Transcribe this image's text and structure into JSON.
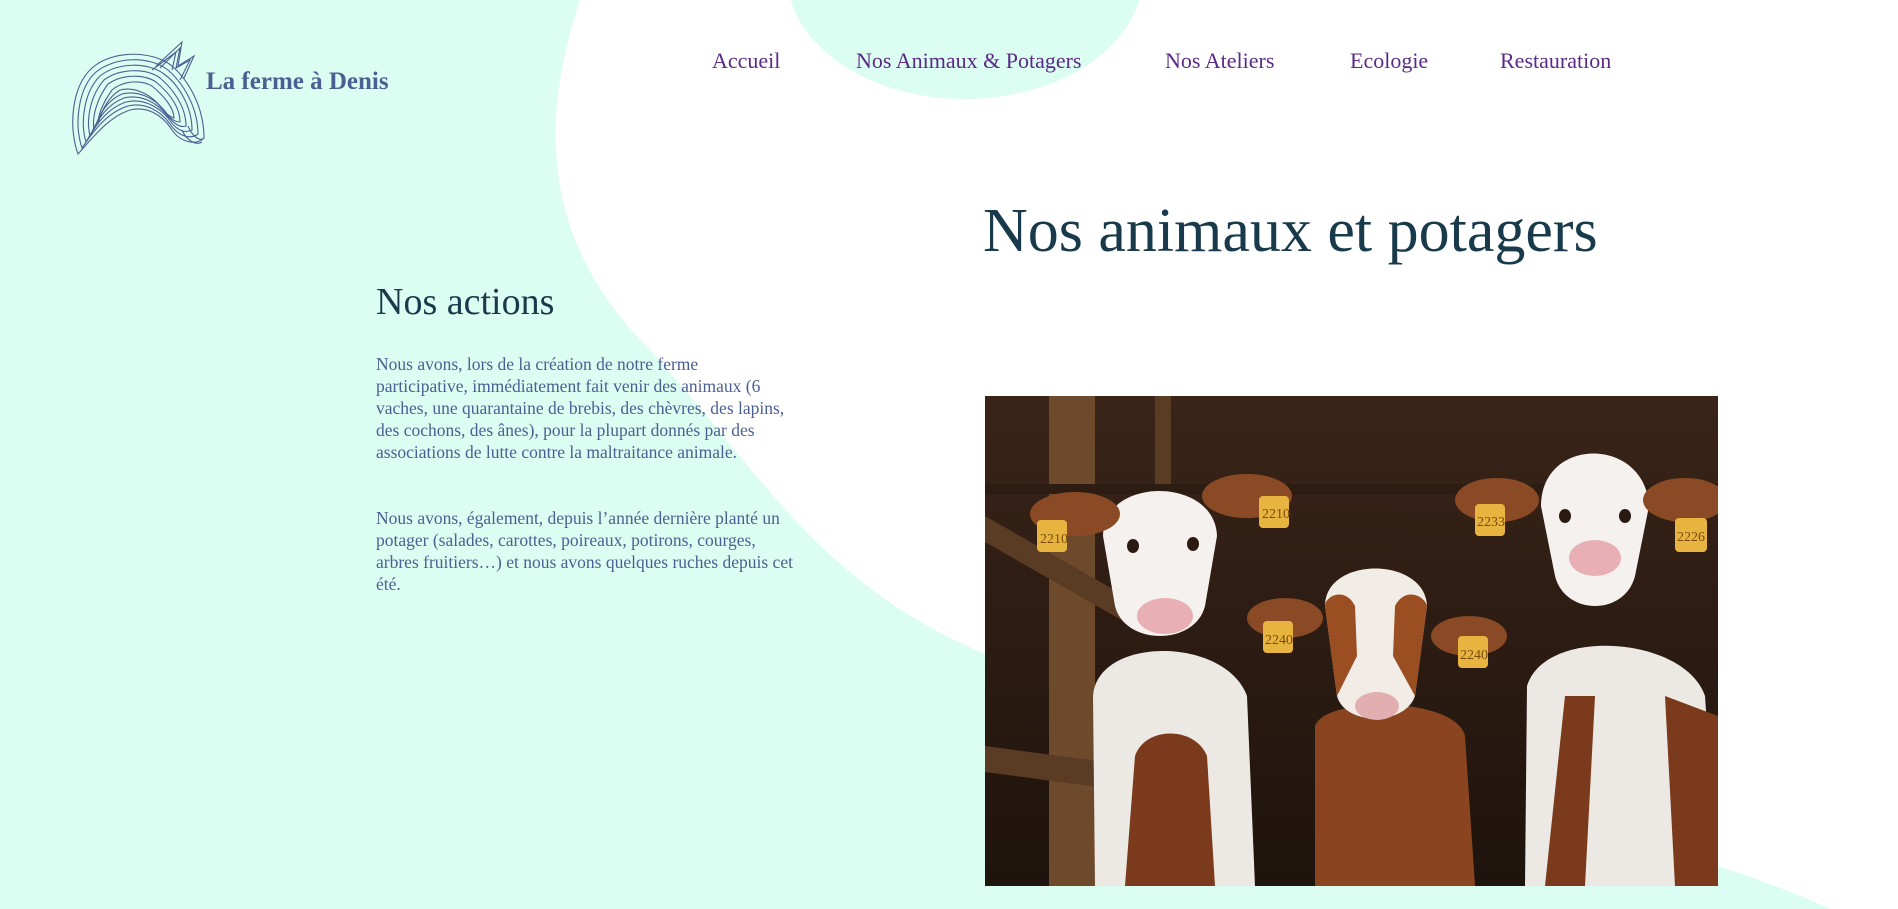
{
  "brand": {
    "name": "La ferme à Denis",
    "logo_icon": "horse-head-line-art-icon"
  },
  "nav": {
    "items": [
      "Accueil",
      "Nos Animaux & Potagers",
      "Nos Ateliers",
      "Ecologie",
      "Restauration"
    ]
  },
  "page_title": "Nos animaux et potagers",
  "actions": {
    "title": "Nos actions",
    "paragraphs": [
      "Nous avons, lors de la création de notre ferme participative, immédiatement fait venir des animaux (6 vaches, une quarantaine de brebis, des chèvres, des lapins, des cochons, des ânes), pour la plupart donnés par des associations de lutte contre la maltraitance animale.",
      "Nous avons, également, depuis l’année dernière planté un potager (salades, carottes, poireaux, potirons, courges, arbres fruitiers…) et nous avons quelques ruches depuis cet été."
    ]
  },
  "image": {
    "subject": "three-calves-in-barn",
    "ear_tags": [
      "2210",
      "2210",
      "2233",
      "2226",
      "2240",
      "2240"
    ]
  },
  "colors": {
    "mint_background": "#dcfdf1",
    "white_shape": "#ffffff",
    "heading": "#183a4b",
    "nav_text": "#5a2a86",
    "body_text": "#4c5f93",
    "brand_text": "#4c5f93"
  }
}
